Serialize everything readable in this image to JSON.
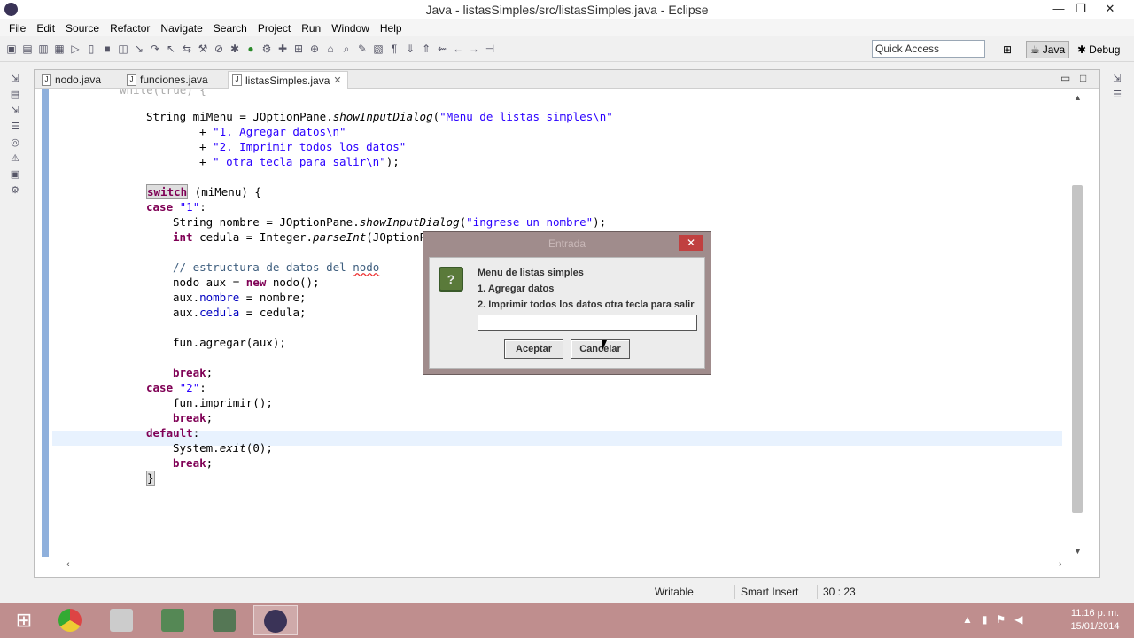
{
  "window": {
    "title": "Java - listasSimples/src/listasSimples.java - Eclipse",
    "minimize": "—",
    "maximize": "❐",
    "close": "✕"
  },
  "menu": [
    "File",
    "Edit",
    "Source",
    "Refactor",
    "Navigate",
    "Search",
    "Project",
    "Run",
    "Window",
    "Help"
  ],
  "toolbar": {
    "quick_access_placeholder": "Quick Access",
    "perspective_java": "Java",
    "perspective_debug": "Debug"
  },
  "editor": {
    "tabs": [
      {
        "label": "nodo.java"
      },
      {
        "label": "funciones.java"
      },
      {
        "label": "listasSimples.java"
      }
    ],
    "tab_close": "✕",
    "code": {
      "l0": "while(true) {",
      "l1_pre": "String miMenu = JOptionPane.",
      "l1_method": "showInputDialog",
      "l1_str": "\"Menu de listas simples\\n\"",
      "l2_str": "\"1. Agregar datos\\n\"",
      "l3_str": "\"2. Imprimir todos los datos\"",
      "l4_str": "\" otra tecla para salir\\n\"",
      "l5_kw": "switch",
      "l5_rest": " (miMenu) {",
      "l6_kw": "case",
      "l6_str": "\"1\"",
      "l7_pre": "String nombre = JOptionPane.",
      "l7_method": "showInputDialog",
      "l7_str": "\"ingrese un nombre\"",
      "l8_kw": "int",
      "l8_rest": " cedula = Integer.",
      "l8_method": "parseInt",
      "l8_tail": "(JOptionP",
      "l9_comment_a": "// estructura de datos del ",
      "l9_comment_b": "nodo",
      "l10_pre": "nodo aux = ",
      "l10_kw": "new",
      "l10_rest": " nodo();",
      "l11_pre": "aux.",
      "l11_field": "nombre",
      "l11_rest": " = nombre;",
      "l12_pre": "aux.",
      "l12_field": "cedula",
      "l12_rest": " = cedula;",
      "l13": "fun.agregar(aux);",
      "l14_kw": "break",
      "l15_kw": "case",
      "l15_str": "\"2\"",
      "l16": "fun.imprimir();",
      "l17_kw": "break",
      "l18_kw": "default",
      "l19_pre": "System.",
      "l19_method": "exit",
      "l19_rest": "(0);",
      "l20_kw": "break",
      "l21": "}"
    }
  },
  "dialog": {
    "title": "Entrada",
    "close": "✕",
    "icon": "question-icon",
    "icon_glyph": "?",
    "line1": "Menu de listas simples",
    "line2": "1. Agregar datos",
    "line3": "2. Imprimir todos los datos otra tecla para salir",
    "input_value": "",
    "ok_label": "Aceptar",
    "cancel_label": "Cancelar"
  },
  "status": {
    "writable": "Writable",
    "insert_mode": "Smart Insert",
    "position": "30 : 23"
  },
  "taskbar": {
    "apps": [
      "chrome-icon",
      "notepad-icon",
      "network-icon",
      "paint-icon",
      "eclipse-icon"
    ],
    "time": "11:16 p. m.",
    "date": "15/01/2014"
  },
  "colors": {
    "accent_keyword": "#7f0055",
    "string": "#2a00ff",
    "field": "#0000c0",
    "taskbar": "#bf8e8e"
  }
}
